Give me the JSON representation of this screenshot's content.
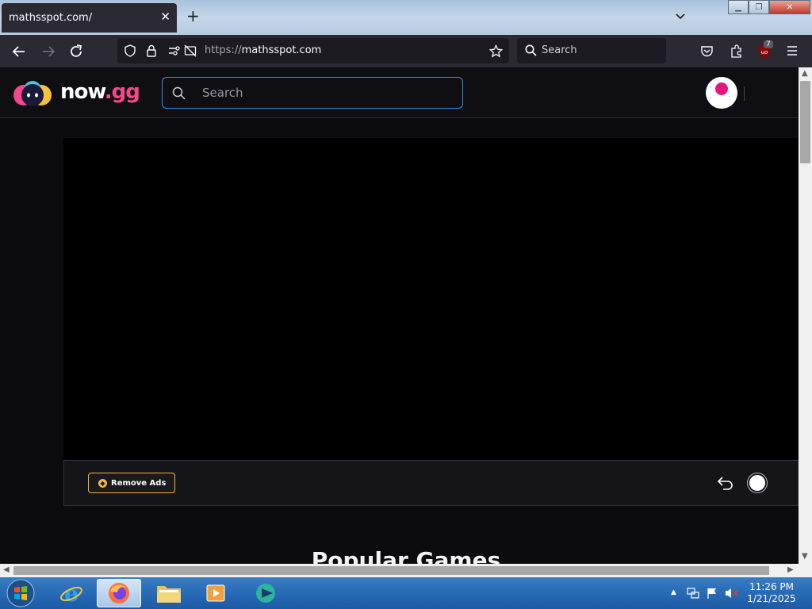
{
  "browser": {
    "tab_title": "mathsspot.com/",
    "tab_close": "✕",
    "new_tab": "+",
    "url_prefix": "https://",
    "url_domain": "mathsspot.com",
    "search_placeholder": "Search",
    "extension_badge": "7"
  },
  "site": {
    "logo_text_main": "now",
    "logo_text_accent": ".gg",
    "search_placeholder": "Search",
    "accent_color": "#f7478b",
    "search_border_color": "#3a8ee0"
  },
  "game_bar": {
    "remove_ads_label": "Remove Ads",
    "accent_color": "#f0b73a"
  },
  "sections": {
    "popular_heading": "Popular Games"
  },
  "taskbar": {
    "time": "11:26 PM",
    "date": "1/21/2025",
    "apps": [
      "internet-explorer",
      "firefox",
      "file-explorer",
      "media-player",
      "app"
    ]
  }
}
